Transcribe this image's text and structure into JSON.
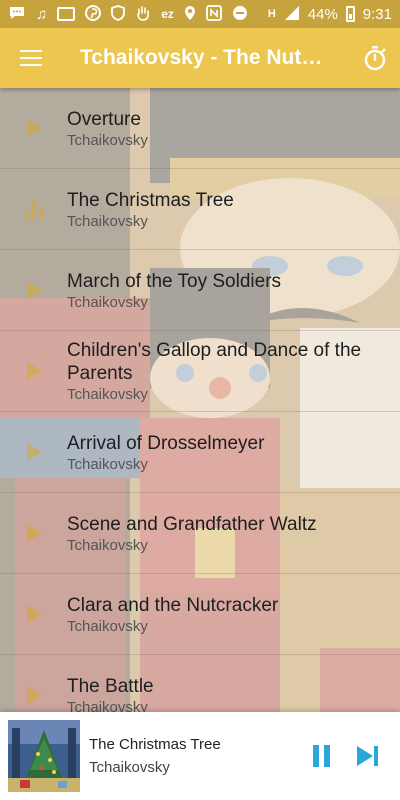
{
  "status_bar": {
    "battery": "44%",
    "time": "9:31",
    "network": "H",
    "left_icons": [
      "chat-icon",
      "music-note-icon",
      "inbox-icon",
      "pinterest-icon",
      "shield-icon",
      "hand-icon",
      "ez-icon",
      "location-icon",
      "nfc-icon",
      "dnd-icon"
    ],
    "ez_text": "ez"
  },
  "app_bar": {
    "title": "Tchaikovsky - The Nutcracker",
    "background": "#ecc64f"
  },
  "tracks": [
    {
      "title": "Overture",
      "artist": "Tchaikovsky",
      "icon": "play-icon"
    },
    {
      "title": "The Christmas Tree",
      "artist": "Tchaikovsky",
      "icon": "equalizer-icon"
    },
    {
      "title": "March of the Toy Soldiers",
      "artist": "Tchaikovsky",
      "icon": "play-icon"
    },
    {
      "title": "Children's Gallop and Dance of the Parents",
      "artist": "Tchaikovsky",
      "icon": "play-icon"
    },
    {
      "title": "Arrival of Drosselmeyer",
      "artist": "Tchaikovsky",
      "icon": "play-icon"
    },
    {
      "title": "Scene and Grandfather Waltz",
      "artist": "Tchaikovsky",
      "icon": "play-icon"
    },
    {
      "title": "Clara and the Nutcracker",
      "artist": "Tchaikovsky",
      "icon": "play-icon"
    },
    {
      "title": "The Battle",
      "artist": "Tchaikovsky",
      "icon": "play-icon"
    }
  ],
  "now_playing": {
    "title": "The Christmas Tree",
    "artist": "Tchaikovsky",
    "accent": "#2aa7d8"
  }
}
